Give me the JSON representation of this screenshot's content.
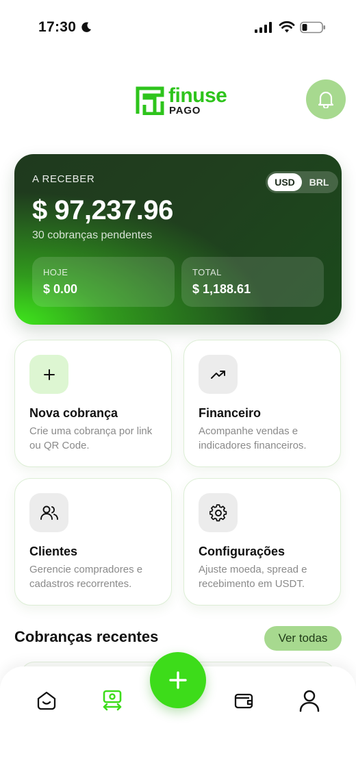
{
  "status_bar": {
    "time": "17:30",
    "icons": [
      "moon-icon",
      "signal-icon",
      "wifi-icon",
      "battery-icon"
    ]
  },
  "header": {
    "logo_word": "finuse",
    "logo_sub": "PAGO",
    "notification_icon": "bell-icon"
  },
  "balance": {
    "label": "A RECEBER",
    "currency_options": [
      "USD",
      "BRL"
    ],
    "selected_currency": "USD",
    "amount": "$ 97,237.96",
    "subtitle": "30 cobranças pendentes",
    "hoje": {
      "label": "HOJE",
      "value": "$ 0.00"
    },
    "total": {
      "label": "TOTAL",
      "value": "$ 1,188.61"
    }
  },
  "actions": [
    {
      "title": "Nova cobrança",
      "desc": "Crie uma cobrança por link ou QR Code.",
      "icon": "plus-icon"
    },
    {
      "title": "Financeiro",
      "desc": "Acompanhe vendas e indicadores financeiros.",
      "icon": "trending-up-icon"
    },
    {
      "title": "Clientes",
      "desc": "Gerencie compradores e cadastros recorrentes.",
      "icon": "users-icon"
    },
    {
      "title": "Configurações",
      "desc": "Ajuste moeda, spread e recebimento em USDT.",
      "icon": "gear-icon"
    }
  ],
  "recent": {
    "title": "Cobranças recentes",
    "see_all": "Ver todas"
  },
  "nav": {
    "items": [
      "home-icon",
      "charges-icon",
      "add-icon",
      "wallet-icon",
      "profile-icon"
    ],
    "active": "charges-icon"
  },
  "colors": {
    "brand_green": "#3ddc1a",
    "soft_green": "#a7d98f",
    "card_dark": "#1f3a1e"
  }
}
